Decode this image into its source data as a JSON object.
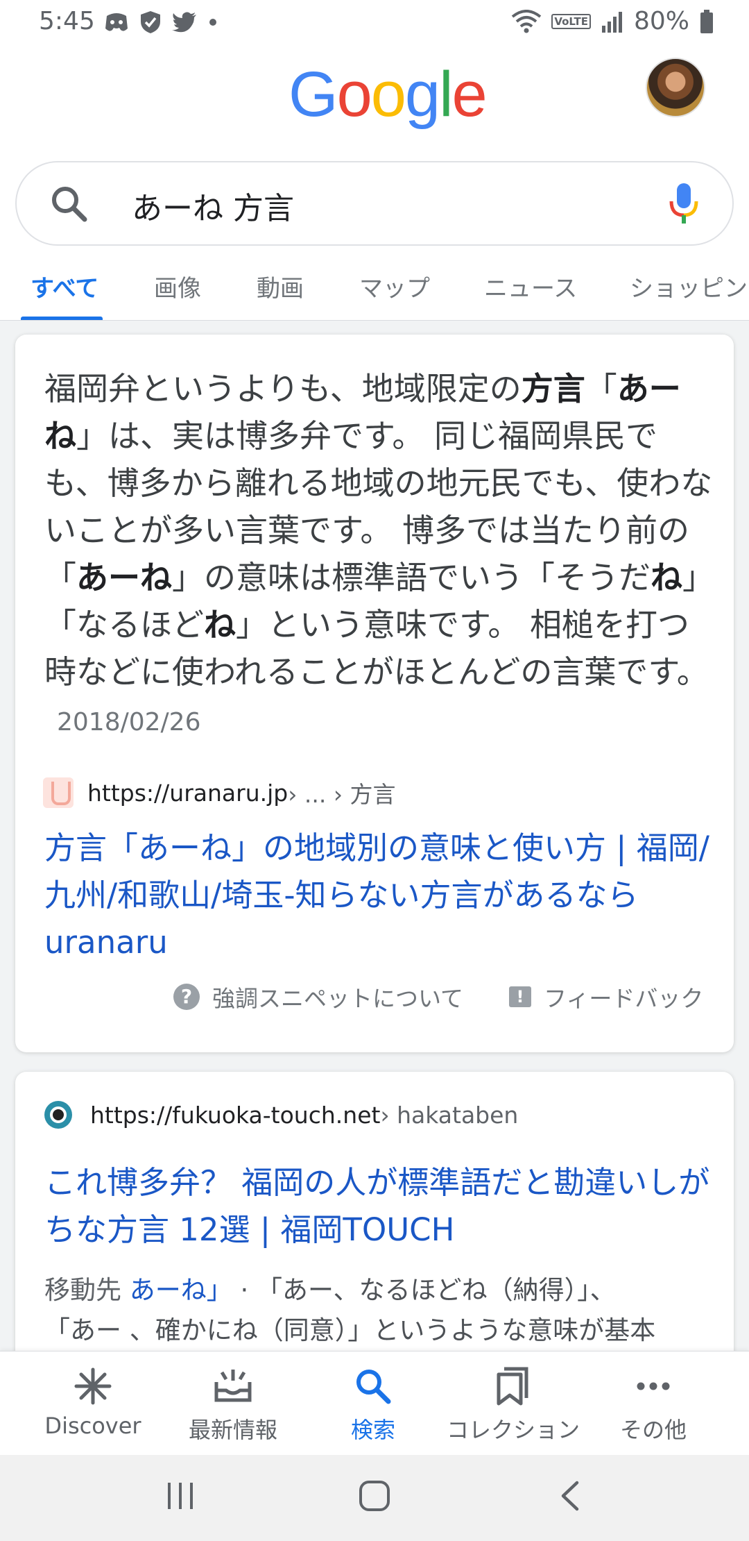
{
  "status_bar": {
    "time": "5:45",
    "battery": "80%",
    "volte": "VoLTE"
  },
  "logo": [
    "G",
    "o",
    "o",
    "g",
    "l",
    "e"
  ],
  "logo_colors": [
    "#4285F4",
    "#EA4335",
    "#FBBC05",
    "#4285F4",
    "#34A853",
    "#EA4335"
  ],
  "search": {
    "query": "あーね 方言"
  },
  "tabs": [
    "すべて",
    "画像",
    "動画",
    "マップ",
    "ニュース",
    "ショッピング"
  ],
  "featured_snippet": {
    "text_parts": [
      "福岡弁というよりも、地域限定の",
      "方言",
      "「",
      "あーね",
      "」は、実は博多弁です。 同じ福岡県民でも、博多から離れる地域の地元民でも、使わないことが多い言葉です。 博多では当たり前の「",
      "あーね",
      "」の意味は標準語でいう「そうだ",
      "ね",
      "」「なるほど",
      "ね",
      "」という意味です。 相槌を打つ時などに使われることがほとんどの言葉です。"
    ],
    "date": "2018/02/26",
    "source_url": "https://uranaru.jp",
    "source_path": " › ... › 方言",
    "title": "方言「あーね」の地域別の意味と使い方 | 福岡/九州/和歌山/埼玉-知らない方言があるならuranaru",
    "about_label": "強調スニペットについて",
    "feedback_label": "フィードバック"
  },
  "result2": {
    "source_url": "https://fukuoka-touch.net",
    "source_path": " › hakataben",
    "title": "これ博多弁？ 福岡の人が標準語だと勘違いしがちな方言 12選 | 福岡TOUCH",
    "go_to": "移動先",
    "go_link": "あーね」",
    "snippet_line1": " · 「あー、なるほどね（納得）」、",
    "snippet_line2": "「あー 、確かにね（同意）」というような意味が基本"
  },
  "bottom_nav": [
    "Discover",
    "最新情報",
    "検索",
    "コレクション",
    "その他"
  ],
  "accent_color": "#1a73e8"
}
